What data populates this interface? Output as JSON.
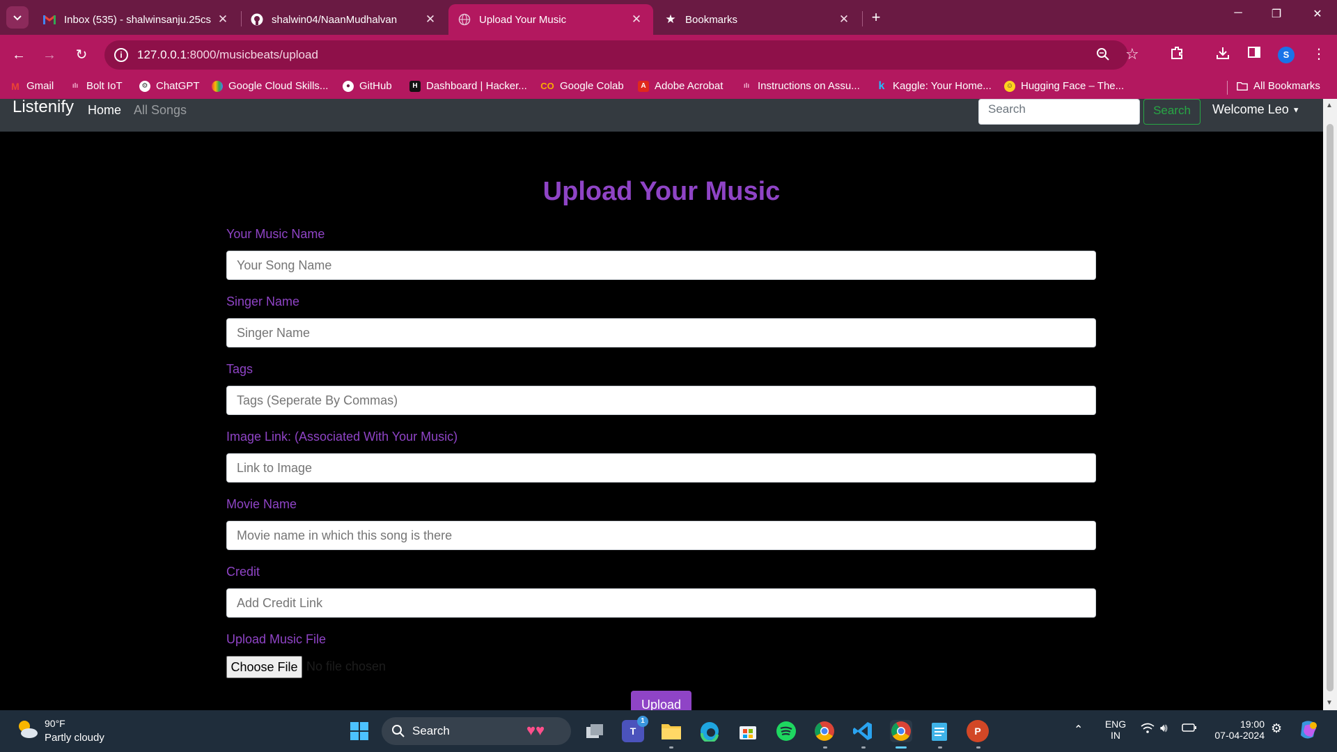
{
  "browser": {
    "tabs": [
      {
        "title": "Inbox (535) - shalwinsanju.25cs"
      },
      {
        "title": "shalwin04/NaanMudhalvan"
      },
      {
        "title": "Upload Your Music"
      },
      {
        "title": "Bookmarks"
      }
    ],
    "url_host": "127.0.0.1",
    "url_path": ":8000/musicbeats/upload",
    "profile_initial": "S",
    "bookmarks": [
      "Gmail",
      "Bolt IoT",
      "ChatGPT",
      "Google Cloud Skills...",
      "GitHub",
      "Dashboard | Hacker...",
      "Google Colab",
      "Adobe Acrobat",
      "Instructions on Assu...",
      "Kaggle: Your Home...",
      "Hugging Face – The..."
    ],
    "all_bookmarks": "All Bookmarks"
  },
  "navbar": {
    "brand": "Listenify",
    "home": "Home",
    "all_songs": "All Songs",
    "search_placeholder": "Search",
    "search_button": "Search",
    "welcome": "Welcome Leo"
  },
  "form": {
    "title": "Upload Your Music",
    "music_name": {
      "label": "Your Music Name",
      "placeholder": "Your Song Name"
    },
    "singer": {
      "label": "Singer Name",
      "placeholder": "Singer Name"
    },
    "tags": {
      "label": "Tags",
      "placeholder": "Tags (Seperate By Commas)"
    },
    "image": {
      "label": "Image Link: (Associated With Your Music)",
      "placeholder": "Link to Image"
    },
    "movie": {
      "label": "Movie Name",
      "placeholder": "Movie name in which this song is there"
    },
    "credit": {
      "label": "Credit",
      "placeholder": "Add Credit Link"
    },
    "file": {
      "label": "Upload Music File",
      "button": "Choose File",
      "status": "No file chosen"
    },
    "submit": "Upload"
  },
  "taskbar": {
    "weather_temp": "90°F",
    "weather_desc": "Partly cloudy",
    "search_label": "Search",
    "teams_badge": "1",
    "lang_top": "ENG",
    "lang_bottom": "IN",
    "time": "19:00",
    "date": "07-04-2024"
  },
  "colors": {
    "browser_frame": "#6a1a43",
    "browser_accent": "#b3185f",
    "purple_accent": "#8f44c6",
    "navbar_bg": "#343a40",
    "search_green": "#28a745"
  }
}
